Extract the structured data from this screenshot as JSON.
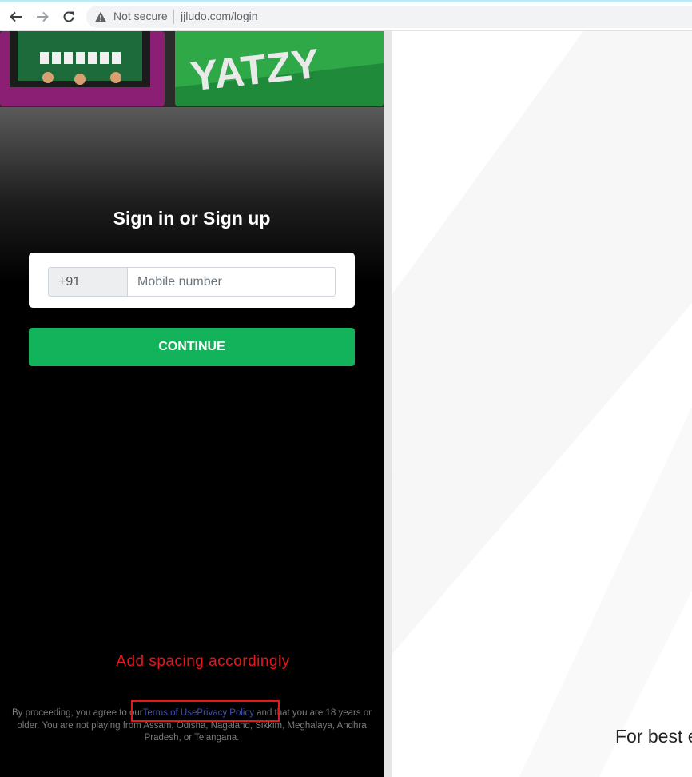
{
  "browser": {
    "security_label": "Not secure",
    "url": "jjludo.com/login",
    "icons": [
      "back-arrow-icon",
      "forward-arrow-icon",
      "reload-icon",
      "warning-icon"
    ]
  },
  "banner": {
    "game_text": "YATZY"
  },
  "login": {
    "title": "Sign in or Sign up",
    "country_code": "+91",
    "mobile_placeholder": "Mobile number",
    "continue_label": "CONTINUE"
  },
  "annotation": {
    "text": "Add spacing accordingly",
    "color": "#e8161c"
  },
  "legal": {
    "prefix": "By proceeding, you agree to our",
    "terms_link": "Terms of Use",
    "privacy_link": "Privacy Policy",
    "suffix": " and that you are 18 years or older. You are not playing from Assam, Odisha, Nagaland, Sikkim, Meghalaya, Andhra Pradesh, or Telangana."
  },
  "right_panel": {
    "text": "For best e"
  },
  "colors": {
    "continue_green": "#12b35b",
    "link_blue": "#3f51b5",
    "panel_black": "#000000"
  }
}
